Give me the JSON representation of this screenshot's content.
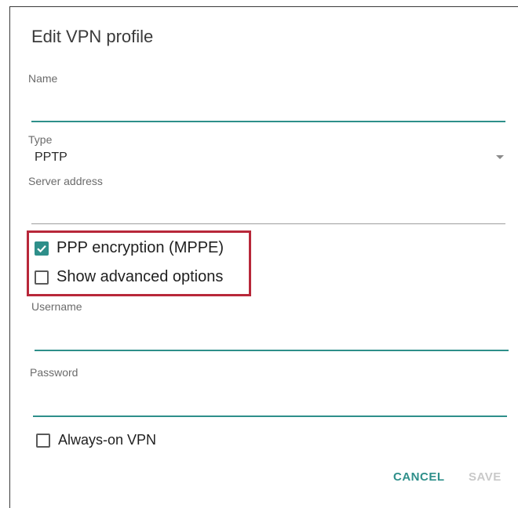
{
  "dialog": {
    "title": "Edit VPN profile"
  },
  "fields": {
    "name": {
      "label": "Name",
      "value": ""
    },
    "type": {
      "label": "Type",
      "value": "PPTP"
    },
    "server_address": {
      "label": "Server address",
      "value": ""
    },
    "username": {
      "label": "Username",
      "value": ""
    },
    "password": {
      "label": "Password",
      "value": ""
    }
  },
  "options": {
    "ppp_encryption": {
      "label": "PPP encryption (MPPE)",
      "checked": true
    },
    "show_advanced": {
      "label": "Show advanced options",
      "checked": false
    },
    "always_on": {
      "label": "Always-on VPN",
      "checked": false
    }
  },
  "buttons": {
    "cancel": "CANCEL",
    "save": "SAVE"
  },
  "colors": {
    "accent": "#2e8f8a",
    "highlight": "#b8283a",
    "disabled": "#c9c9c9"
  },
  "icons": {
    "checkbox_checked": "checkbox-checked-icon",
    "checkbox_unchecked": "checkbox-unchecked-icon",
    "dropdown": "dropdown-arrow-icon"
  }
}
